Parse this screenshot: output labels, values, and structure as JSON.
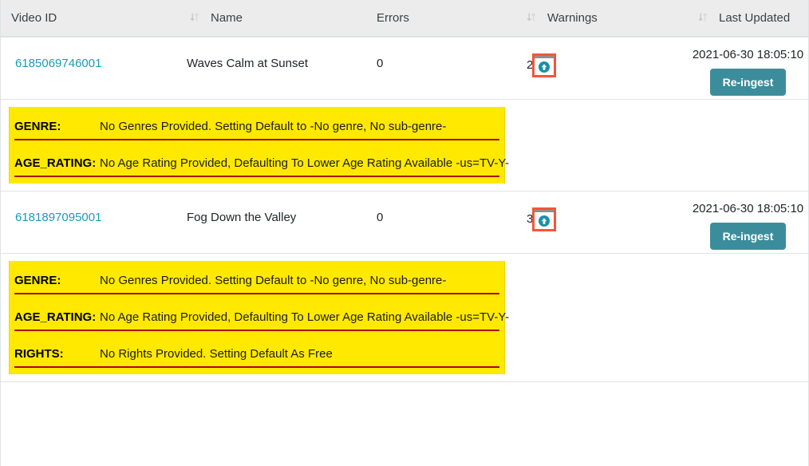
{
  "table": {
    "columns": [
      {
        "label": "Video ID",
        "sortable": true,
        "sort_icon": "sort-updown-icon"
      },
      {
        "label": "Name",
        "sortable": true,
        "sort_icon": "sort-updown-icon"
      },
      {
        "label": "Errors",
        "sortable": true,
        "sort_icon": "sort-updown-icon"
      },
      {
        "label": "Warnings",
        "sortable": true,
        "sort_icon": "sort-updown-icon"
      },
      {
        "label": "Last Updated",
        "sortable": true,
        "sort_icon": "sort-updown-icon"
      }
    ],
    "rows": [
      {
        "video_id": "6185069746001",
        "name": "Waves Calm at Sunset",
        "errors": "0",
        "warnings_count": "2",
        "warnings_toggle_icon": "arrow-up-circle-icon",
        "last_updated": "2021-06-30 18:05:10",
        "reingest_label": "Re-ingest",
        "details": [
          {
            "key": "GENRE:",
            "value": "No Genres Provided. Setting Default to -No genre, No sub-genre-"
          },
          {
            "key": "AGE_RATING:",
            "value": "No Age Rating Provided, Defaulting To Lower Age Rating Available -us=TV-Y-"
          }
        ]
      },
      {
        "video_id": "6181897095001",
        "name": "Fog Down the Valley",
        "errors": "0",
        "warnings_count": "3",
        "warnings_toggle_icon": "arrow-up-circle-icon",
        "last_updated": "2021-06-30 18:05:10",
        "reingest_label": "Re-ingest",
        "details": [
          {
            "key": "GENRE:",
            "value": "No Genres Provided. Setting Default to -No genre, No sub-genre-"
          },
          {
            "key": "AGE_RATING:",
            "value": "No Age Rating Provided, Defaulting To Lower Age Rating Available -us=TV-Y-"
          },
          {
            "key": "RIGHTS:",
            "value": "No Rights Provided. Setting Default As Free"
          }
        ]
      }
    ]
  },
  "colors": {
    "link": "#1a9bb5",
    "button": "#3c8d9b",
    "warning_panel": "#ffe900",
    "warning_rule": "#b00000",
    "highlight_outline": "#f4553d",
    "header_bg": "#ececec"
  }
}
